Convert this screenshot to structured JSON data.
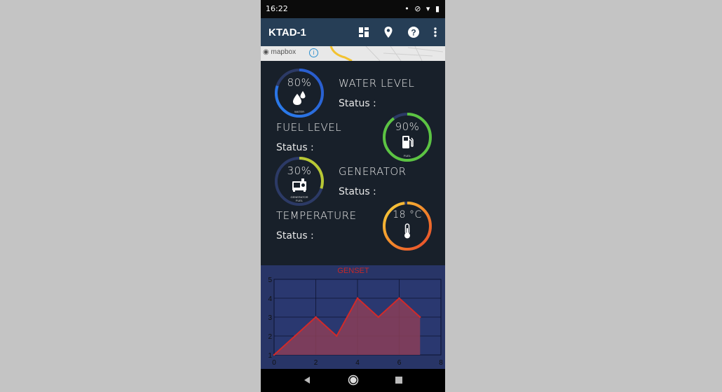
{
  "status_bar": {
    "time": "16:22"
  },
  "app_bar": {
    "title": "KTAD-1"
  },
  "map": {
    "attribution": "mapbox",
    "info_symbol": "i"
  },
  "gauges": {
    "water": {
      "value_text": "80%",
      "caption": "WATER",
      "level": 0.8,
      "colors": [
        "#2a7ff0",
        "#2957c8"
      ]
    },
    "fuel": {
      "value_text": "90%",
      "caption": "FUEL",
      "level": 0.9,
      "colors": [
        "#6fd24a",
        "#4cbb3a"
      ]
    },
    "generator": {
      "value_text": "30%",
      "caption_line1": "GENERATOR",
      "caption_line2": "FUEL",
      "level": 0.3,
      "colors": [
        "#c6d23a",
        "#a5b82e"
      ]
    },
    "temperature": {
      "value_text": "18 °C",
      "level": 0.98,
      "colors": [
        "#f6d33a",
        "#f38a2a",
        "#e7462a"
      ]
    }
  },
  "labels": {
    "water_level": "WATER LEVEL",
    "fuel_level": "FUEL LEVEL",
    "generator": "GENERATOR",
    "temperature": "TEMPERATURE",
    "status": "Status :"
  },
  "chart_data": {
    "type": "area",
    "title": "GENSET",
    "x": [
      0,
      1,
      2,
      3,
      4,
      5,
      6,
      7
    ],
    "y": [
      1,
      2,
      3,
      2,
      4,
      3,
      4,
      3
    ],
    "xlim": [
      0,
      8
    ],
    "ylim": [
      1,
      5
    ],
    "x_ticks": [
      0,
      2,
      4,
      6,
      8
    ],
    "y_ticks": [
      1,
      2,
      3,
      4,
      5
    ],
    "grid": true,
    "line_color": "#d12a2a",
    "fill_color": "#8a3e58",
    "title_color": "#c62828"
  },
  "colors": {
    "app_bar": "#263e56",
    "dashboard_bg": "#18202a",
    "chart_bg": "#283567",
    "gauge_track": "#2c3a66"
  }
}
